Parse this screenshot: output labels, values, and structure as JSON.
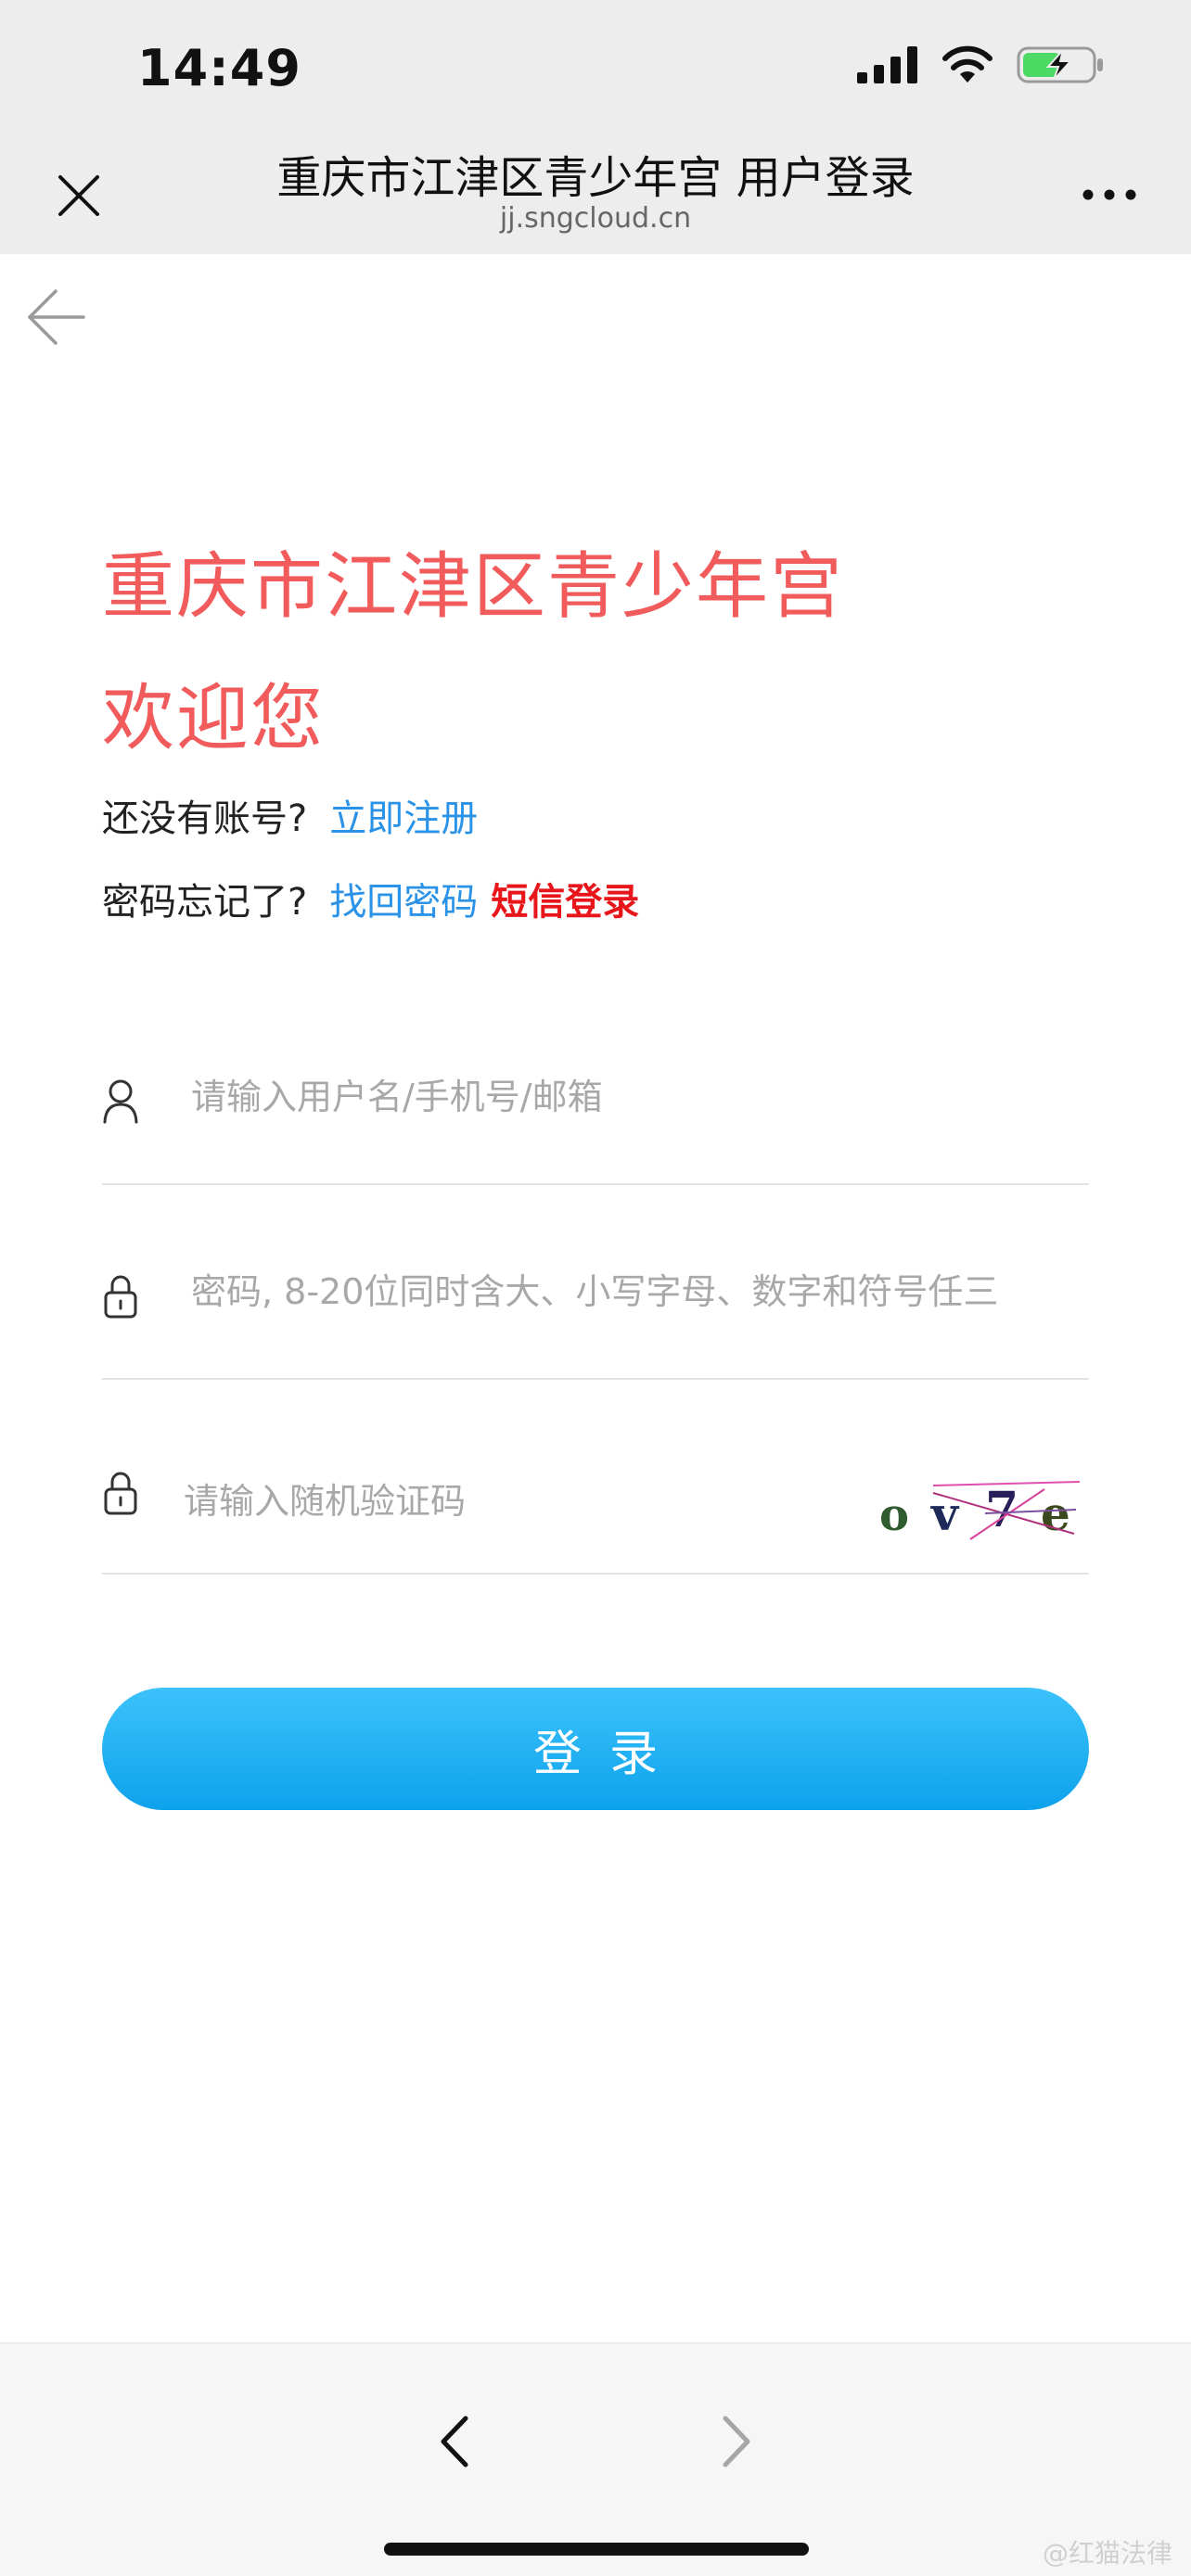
{
  "status_bar": {
    "time": "14:49"
  },
  "browser": {
    "title": "重庆市江津区青少年宫 用户登录",
    "domain": "jj.sngcloud.cn",
    "close_icon": "close-icon",
    "more_icon": "more-dots-icon"
  },
  "page": {
    "back_icon": "arrow-left-icon",
    "brand_title": "重庆市江津区青少年宫",
    "welcome": "欢迎您",
    "register_prompt": "还没有账号?",
    "register_link": "立即注册",
    "forgot_prompt": "密码忘记了?",
    "forgot_link": "找回密码",
    "sms_login_link": "短信登录"
  },
  "form": {
    "username": {
      "value": "",
      "placeholder": "请输入用户名/手机号/邮箱",
      "icon": "user-icon"
    },
    "password": {
      "value": "",
      "placeholder": "密码, 8-20位同时含大、小写字母、数字和符号任三",
      "icon": "lock-icon"
    },
    "captcha": {
      "value": "",
      "placeholder": "请输入随机验证码",
      "icon": "lock-icon",
      "image_text": "ov7e"
    },
    "submit_label": "登录"
  },
  "toolbar": {
    "back_icon": "chevron-left-icon",
    "forward_icon": "chevron-right-icon"
  },
  "watermark": "@红猫法律",
  "colors": {
    "brand_red": "#f25b5b",
    "link_blue": "#2a93e8",
    "sms_red": "#e8151b",
    "button_blue": "#12a6ee",
    "battery_green": "#4cd964"
  }
}
